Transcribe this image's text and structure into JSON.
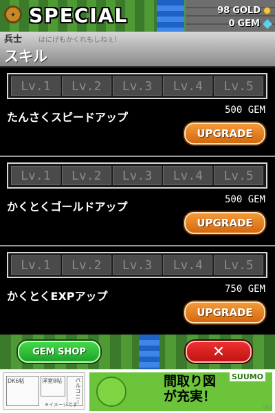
{
  "header": {
    "title": "SPECIAL",
    "gold_amount": "98",
    "gold_label": "GOLD",
    "gem_amount": "0",
    "gem_label": "GEM"
  },
  "section": {
    "behind_text": "兵士",
    "behind_subtext": "はにげもかくれもしねぇ！",
    "title": "スキル"
  },
  "skills": [
    {
      "name": "たんさくスピードアップ",
      "cost": "500 GEM",
      "upgrade_label": "UPGRADE",
      "levels": [
        "Lv.1",
        "Lv.2",
        "Lv.3",
        "Lv.4",
        "Lv.5"
      ]
    },
    {
      "name": "かくとくゴールドアップ",
      "cost": "500 GEM",
      "upgrade_label": "UPGRADE",
      "levels": [
        "Lv.1",
        "Lv.2",
        "Lv.3",
        "Lv.4",
        "Lv.5"
      ]
    },
    {
      "name": "かくとくEXPアップ",
      "cost": "750 GEM",
      "upgrade_label": "UPGRADE",
      "levels": [
        "Lv.1",
        "Lv.2",
        "Lv.3",
        "Lv.4",
        "Lv.5"
      ]
    }
  ],
  "bottom": {
    "gem_shop_label": "GEM SHOP",
    "close_label": "✕"
  },
  "ad": {
    "headline_line1": "間取り図",
    "headline_line2": "が充実！",
    "brand": "SUUMO",
    "room1": "DK6帖",
    "room2": "洋室8帖",
    "room3": "バルコニー",
    "note": "※イメージです",
    "iad": "iAd"
  },
  "colors": {
    "upgrade_orange": "#e07a1e",
    "gem_shop_green": "#2dbf36",
    "close_red": "#d81e1e",
    "level_inactive": "#4a4a4a"
  }
}
